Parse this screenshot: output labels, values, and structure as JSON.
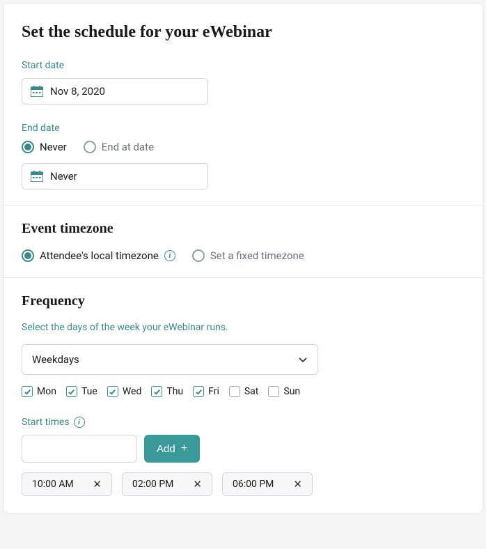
{
  "title": "Set the schedule for your eWebinar",
  "start_date": {
    "label": "Start date",
    "value": "Nov 8, 2020"
  },
  "end_date": {
    "label": "End date",
    "options": {
      "never": "Never",
      "end_at": "End at date"
    },
    "selected": "never",
    "value": "Never"
  },
  "timezone": {
    "heading": "Event timezone",
    "options": {
      "attendee": "Attendee's local timezone",
      "fixed": "Set a fixed timezone"
    },
    "selected": "attendee"
  },
  "frequency": {
    "heading": "Frequency",
    "subtext": "Select the days of the week your eWebinar runs.",
    "preset": "Weekdays",
    "days": [
      {
        "label": "Mon",
        "checked": true
      },
      {
        "label": "Tue",
        "checked": true
      },
      {
        "label": "Wed",
        "checked": true
      },
      {
        "label": "Thu",
        "checked": true
      },
      {
        "label": "Fri",
        "checked": true
      },
      {
        "label": "Sat",
        "checked": false
      },
      {
        "label": "Sun",
        "checked": false
      }
    ]
  },
  "start_times": {
    "label": "Start times",
    "add_button": "Add",
    "times": [
      "10:00 AM",
      "02:00 PM",
      "06:00 PM"
    ]
  },
  "colors": {
    "accent": "#3a8a8a"
  }
}
